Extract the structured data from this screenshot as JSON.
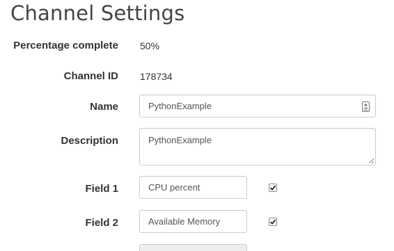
{
  "page": {
    "title": "Channel Settings"
  },
  "rows": {
    "percentage": {
      "label": "Percentage complete",
      "value": "50%"
    },
    "channel_id": {
      "label": "Channel ID",
      "value": "178734"
    },
    "name": {
      "label": "Name",
      "value": "PythonExample"
    },
    "description": {
      "label": "Description",
      "value": "PythonExample"
    },
    "field1": {
      "label": "Field 1",
      "value": "CPU percent",
      "checked": true
    },
    "field2": {
      "label": "Field 2",
      "value": "Available Memory",
      "checked": true
    }
  }
}
